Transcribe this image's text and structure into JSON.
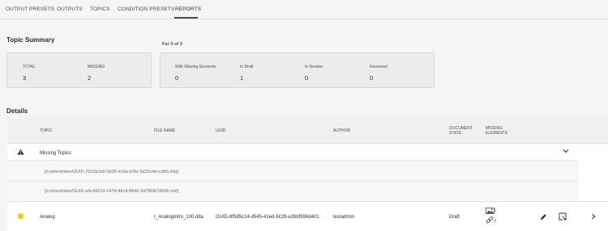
{
  "tabs": [
    {
      "label": "OUTPUT PRESETS"
    },
    {
      "label": "OUTPUTS"
    },
    {
      "label": "TOPICS"
    },
    {
      "label": "CONDITION PRESETS"
    },
    {
      "label": "REPORTS"
    }
  ],
  "topic_summary": {
    "title": "Topic Summary",
    "total_label": "TOTAL",
    "total_value": "3",
    "missing_label": "MISSING",
    "missing_value": "2"
  },
  "for_label": "For 3 of 3",
  "status_summary": {
    "items": [
      {
        "label": "With Missing Elements",
        "value": "0"
      },
      {
        "label": "In Draft",
        "value": "1"
      },
      {
        "label": "In Review",
        "value": "0"
      },
      {
        "label": "Reviewed",
        "value": "0"
      }
    ]
  },
  "details": {
    "title": "Details",
    "columns": {
      "topic": "TOPIC",
      "file_name": "FILE NAME",
      "uuid": "UUID",
      "author": "AUTHOR",
      "document_state_1": "DOCUMENT",
      "document_state_2": "STATE",
      "missing_elements_1": "MISSING",
      "missing_elements_2": "ELEMENTS"
    },
    "group": {
      "label": "Missing Topics",
      "paths": [
        "[/content/dam/GUID-7010b1b6-5b06-4c9a-b3fa-3a29c4eccd56.dita]",
        "[/content/dam/GUID-a5c48233-147b-48cd-8840-9d7f60b7d60b.xml]"
      ]
    },
    "row": {
      "topic": "Analog",
      "file_name": "r_AnalogIntro_100.dita",
      "uuid": "GUID-8f585c14-d545-41ed-9c29-e2bbf596d401",
      "author": "testadmin",
      "state": "Draft",
      "missing_images": "0",
      "missing_links": "0"
    }
  },
  "colors": {
    "draft_status": "#f0c419",
    "card_bg": "#ececec"
  }
}
